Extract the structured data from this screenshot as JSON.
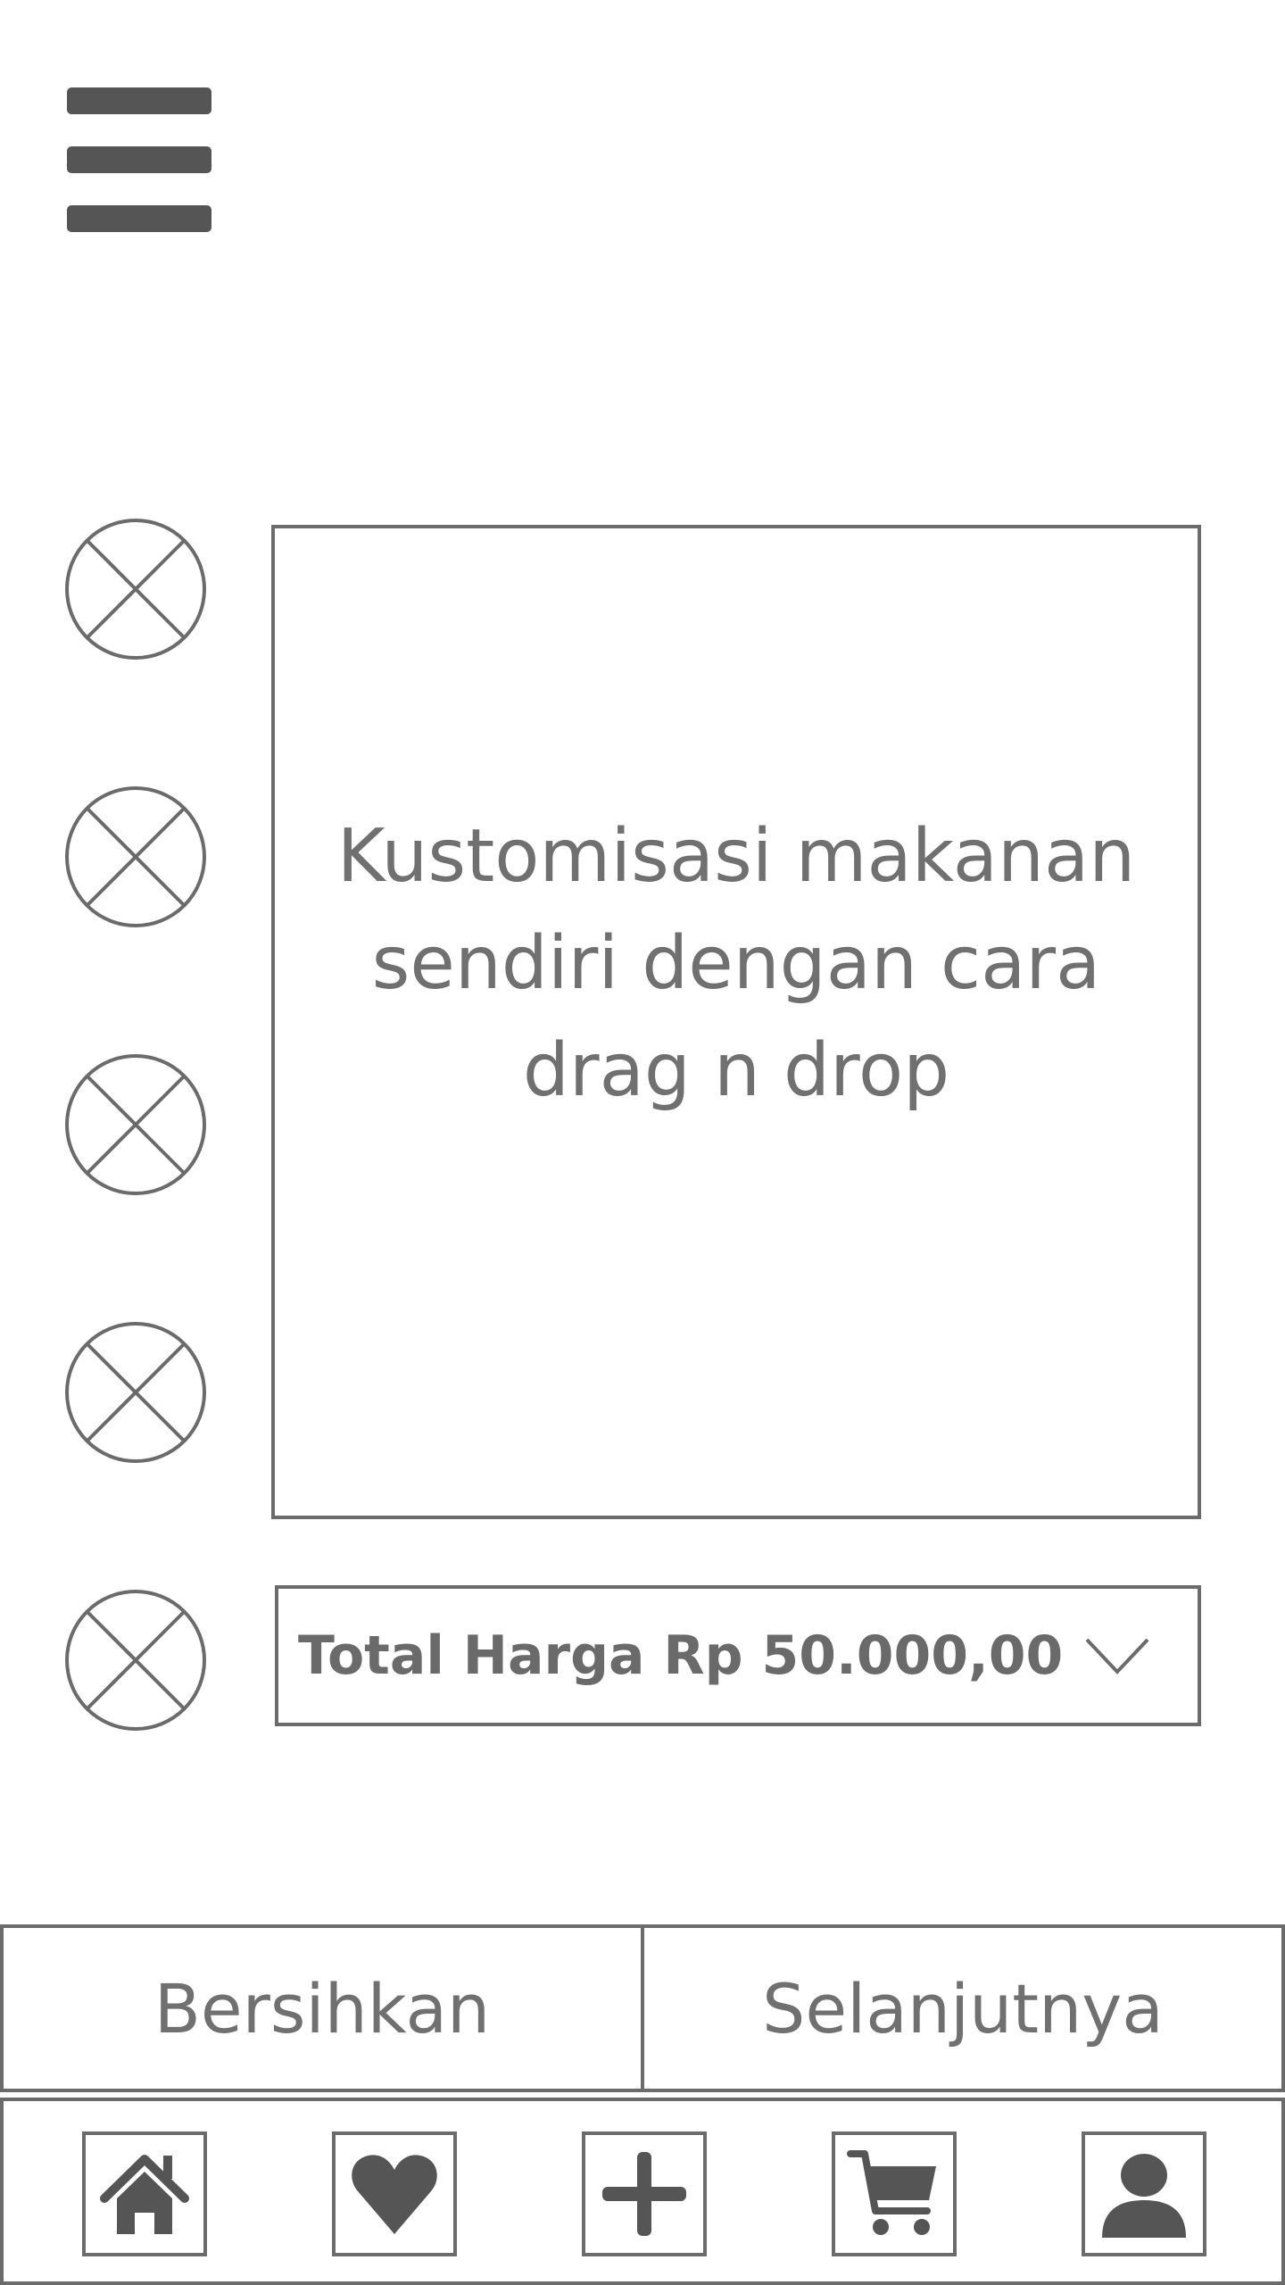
{
  "canvas": {
    "instruction": "Kustomisasi makanan sendiri dengan cara drag n drop"
  },
  "total": {
    "label": "Total Harga Rp 50.000,00"
  },
  "actions": {
    "clear_label": "Bersihkan",
    "next_label": "Selanjutnya"
  },
  "ingredients": [
    {
      "icon": "image-placeholder-icon"
    },
    {
      "icon": "image-placeholder-icon"
    },
    {
      "icon": "image-placeholder-icon"
    },
    {
      "icon": "image-placeholder-icon"
    },
    {
      "icon": "image-placeholder-icon"
    }
  ],
  "nav": [
    {
      "icon": "home-icon"
    },
    {
      "icon": "heart-icon"
    },
    {
      "icon": "plus-icon"
    },
    {
      "icon": "cart-icon"
    },
    {
      "icon": "user-icon"
    }
  ],
  "colors": {
    "stroke": "#6b6b6b",
    "icon_fill": "#555555",
    "text": "#707070"
  }
}
